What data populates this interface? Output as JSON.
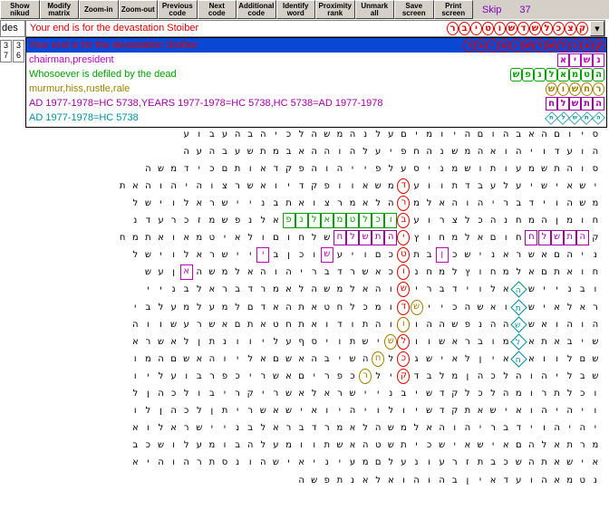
{
  "toolbar": {
    "buttons": [
      {
        "label": "Show\nnikud"
      },
      {
        "label": "Modify\nmatrix"
      },
      {
        "label": "Zoom-in"
      },
      {
        "label": "Zoom-out"
      },
      {
        "label": "Previous\ncode"
      },
      {
        "label": "Next\ncode"
      },
      {
        "label": "Additional\ncode"
      },
      {
        "label": "Identify\nword"
      },
      {
        "label": "Proximity\nrank"
      },
      {
        "label": "Unmark\nall"
      },
      {
        "label": "Save\nscreen"
      },
      {
        "label": "Print\nscreen"
      }
    ],
    "skip_label": "Skip",
    "skip_value": "37"
  },
  "des_box": {
    "value": "des"
  },
  "combo": {
    "value": "Your end is for the devastation Stoiber",
    "glyphs": [
      "ק",
      "צ",
      "כ",
      "ל",
      "ש",
      "ד",
      "ש",
      "ו",
      "ט",
      "י",
      "ב",
      "ר"
    ],
    "glyph_color": "#e00000"
  },
  "dropdown": {
    "items": [
      {
        "text": "Your end is for the devastation Stoiber",
        "color": "#e00000",
        "glyphs": [
          "ק",
          "צ",
          "כ",
          "ל",
          "ש",
          "ד",
          "ש",
          "ו",
          "ט",
          "י",
          "ב",
          "ר"
        ],
        "shape": "oval",
        "gcolor": "#e00000",
        "selected": true
      },
      {
        "text": "chairman,president",
        "color": "#c000c0",
        "glyphs": [
          "נ",
          "ש",
          "י",
          "א"
        ],
        "shape": "box",
        "gcolor": "#c000c0",
        "selected": false
      },
      {
        "text": "Whosoever is defiled by the dead",
        "color": "#00a000",
        "glyphs": [
          "ה",
          "ט",
          "מ",
          "א",
          "ל",
          "נ",
          "פ",
          "ש"
        ],
        "shape": "hex",
        "gcolor": "#00a000",
        "selected": false
      },
      {
        "text": "murmur,hiss,rustle,rale",
        "color": "#a08000",
        "glyphs": [
          "ר",
          "ח",
          "ש",
          "ו",
          "ש"
        ],
        "shape": "oval",
        "gcolor": "#a08000",
        "selected": false
      },
      {
        "text": "AD 1977-1978=HC 5738,YEARS 1977-1978=HC 5738,HC 5738=AD 1977-1978",
        "color": "#a000a0",
        "glyphs": [
          "ה",
          "ת",
          "ש",
          "ל",
          "ח"
        ],
        "shape": "box",
        "gcolor": "#a000a0",
        "selected": false
      },
      {
        "text": "AD 1977-1978=HC 5738",
        "color": "#0090a0",
        "glyphs": [
          "ה",
          "ת",
          "ש",
          "ל",
          "ח"
        ],
        "shape": "diamond",
        "gcolor": "#0090a0",
        "selected": false
      }
    ]
  },
  "mini_cells": [
    "3\n7",
    "3\n6"
  ],
  "grid_rows": [
    "",
    "",
    "",
    "",
    "",
    "ס י ו ם ה א ב ה ו ם ה י ו מ י ם ע ל נ ה מ ש ה ל כ י ה ב ה ע ב ו ע",
    "ה ו ע ד ו י ה ו א ה מ ש נ ה ח פ י ע ל ה ו ה ה א ב מ ת ש ע ב ה ע ה",
    "ס ו ה ת ש מ ע ו ת ו ש מ נ י ס ע ל פ י י ה ו ה פ ק ד א ו ת ם כ י ד מ ש ה",
    "י ש א י ש י ע ל ע ב ד ת ו ו ע ל מ ש א ו ו פ ק ד י ו א ש ר צ ו ה י ה ו ה א ת",
    "מ ש ה ו י ד ב ר י ה ו ה א ל מ ש ה ל א מ ר צ ו א ת ב נ י י ש ר א ל ו י ש ל",
    "ח ו מ ן ה מ ח נ ה כ ל צ ר ו ע ו כ ל ז ב ו כ ל ט מ א ל נ פ ש מ ז כ ר ע ד נ",
    "ק ב ה ת ש ל ח ו ם א ל מ ח ו ץ ל מ ח נ ה ת ש ל ח ו ם ו ל א י ט מ א ו א ת מ ח",
    "נ י ה ם א ש ר א נ י ש כ ן ב ת ו כ ם ו י ע ש ו כ ן ב נ י י ש ר א ל ו י ש ל",
    "ח ו א ת ם א ל מ ח ו ץ ל מ ח נ ה כ א ש ר ד ב ר י ה ו ה א ל מ ש ה כ ן ע ש",
    "ו ב נ י י ש ר א ל ו י ד ב ר י ה ו ה א ל מ ש ה ל א מ ר ד ב ר א ל ב נ י י",
    "ר א ל א י ש א ו א ש ה כ י י ע ש ו מ כ ל ח ט א ת ה א ד ם ל מ ע ל מ ע ל ב י",
    "ה ו ה ו א ש מ ה ה נ פ ש ה ה ו א ו ה ת ו ד ו א ת ח ט א ת ם א ש ר ע ש ו ו ה",
    "ש י ב א ת א ש מ ו ב ר א ש ו ו ח מ י ש ת ו י ס ף ע ל י ו ו נ ת ן ל א ש ר א",
    "ש ם ל ו ו א ם א י ן ל א י ש ג א ל ל ה ש י ב ה א ש ם א ל י ו ה א ש ם ה מ ו",
    "ש ב ל י ה ו ה ל כ ה ן מ ל ב ד א י ל ה כ פ ר י ם א ש ר י כ פ ר ב ו ע ל י ו",
    "ו כ ל ת ר ו מ ה ל כ ל ק ד ש י ב נ י י ש ר א ל א ש ר י ק ר י ב ו ל כ ה ן ל",
    "ו י ה י ה ו א י ש א ת ק ד ש י ו ל ו י ה י ו א י ש א ש ר י ת ן ל כ ה ן ל ו",
    "י ה י ה ו י ד ב ר י ה ו ה א ל מ ש ה ל א מ ר ד ב ר א ל ב נ י י ש ר א ל ו א",
    "מ ר ת א ל ה ם א י ש א י ש כ י ת ש ט ה א ש ת ו ו מ ע ל ה ב ו מ ע ל ו ש כ ב",
    "א י ש א ת ה ש כ ב ת ז ר ע ו נ ע ל ם מ ע י נ י א י ש ה ו נ ס ת ר ה ו ה י א",
    "נ ט מ א ה ו ע ד א י ן ב ה ו ה ו א ל א נ ת פ ש ה"
  ],
  "marks": [
    {
      "row": 8,
      "col": 15,
      "shape": "oval",
      "color": "#e00000",
      "ch": "ד"
    },
    {
      "row": 9,
      "col": 15,
      "shape": "oval",
      "color": "#e00000",
      "ch": "ר"
    },
    {
      "row": 10,
      "col": 15,
      "shape": "oval",
      "color": "#e00000",
      "ch": "ב"
    },
    {
      "row": 11,
      "col": 15,
      "shape": "oval",
      "color": "#e00000",
      "ch": "י"
    },
    {
      "row": 12,
      "col": 15,
      "shape": "oval",
      "color": "#e00000",
      "ch": "ט"
    },
    {
      "row": 13,
      "col": 15,
      "shape": "oval",
      "color": "#e00000",
      "ch": "ו"
    },
    {
      "row": 14,
      "col": 15,
      "shape": "oval",
      "color": "#e00000",
      "ch": "ש"
    },
    {
      "row": 15,
      "col": 15,
      "shape": "oval",
      "color": "#e00000",
      "ch": "ד"
    },
    {
      "row": 16,
      "col": 15,
      "shape": "oval",
      "color": "#e00000",
      "ch": "ש"
    },
    {
      "row": 17,
      "col": 15,
      "shape": "oval",
      "color": "#e00000",
      "ch": "ל"
    },
    {
      "row": 18,
      "col": 15,
      "shape": "oval",
      "color": "#e00000",
      "ch": "כ"
    },
    {
      "row": 19,
      "col": 15,
      "shape": "oval",
      "color": "#e00000",
      "ch": "ק"
    },
    {
      "row": 10,
      "col": 16,
      "shape": "hex",
      "color": "#00a000",
      "ch": "ו"
    },
    {
      "row": 10,
      "col": 17,
      "shape": "hex",
      "color": "#00a000",
      "ch": "כ"
    },
    {
      "row": 10,
      "col": 18,
      "shape": "hex",
      "color": "#00a000",
      "ch": "ל"
    },
    {
      "row": 10,
      "col": 19,
      "shape": "hex",
      "color": "#00a000",
      "ch": "ט"
    },
    {
      "row": 10,
      "col": 20,
      "shape": "hex",
      "color": "#00a000",
      "ch": "מ"
    },
    {
      "row": 10,
      "col": 21,
      "shape": "hex",
      "color": "#00a000",
      "ch": "א"
    },
    {
      "row": 10,
      "col": 22,
      "shape": "hex",
      "color": "#00a000",
      "ch": "ל"
    },
    {
      "row": 10,
      "col": 23,
      "shape": "hex",
      "color": "#00a000",
      "ch": "נ"
    },
    {
      "row": 10,
      "col": 24,
      "shape": "hex",
      "color": "#00a000",
      "ch": "פ"
    },
    {
      "row": 11,
      "col": 1,
      "shape": "box",
      "color": "#a000a0",
      "ch": "ה"
    },
    {
      "row": 11,
      "col": 2,
      "shape": "box",
      "color": "#a000a0",
      "ch": "ת"
    },
    {
      "row": 11,
      "col": 3,
      "shape": "box",
      "color": "#a000a0",
      "ch": "ש"
    },
    {
      "row": 11,
      "col": 4,
      "shape": "box",
      "color": "#a000a0",
      "ch": "ל"
    },
    {
      "row": 11,
      "col": 5,
      "shape": "box",
      "color": "#a000a0",
      "ch": "ח"
    },
    {
      "row": 11,
      "col": 16,
      "shape": "box",
      "color": "#a000a0",
      "ch": "ה"
    },
    {
      "row": 11,
      "col": 17,
      "shape": "box",
      "color": "#a000a0",
      "ch": "ת"
    },
    {
      "row": 11,
      "col": 18,
      "shape": "box",
      "color": "#a000a0",
      "ch": "ש"
    },
    {
      "row": 11,
      "col": 19,
      "shape": "box",
      "color": "#a000a0",
      "ch": "ל"
    },
    {
      "row": 11,
      "col": 20,
      "shape": "box",
      "color": "#a000a0",
      "ch": "ח"
    },
    {
      "row": 12,
      "col": 12,
      "shape": "box",
      "color": "#c000c0",
      "ch": "ן"
    },
    {
      "row": 12,
      "col": 21,
      "shape": "box",
      "color": "#c000c0",
      "ch": "ש"
    },
    {
      "row": 12,
      "col": 26,
      "shape": "box",
      "color": "#c000c0",
      "ch": "י"
    },
    {
      "row": 13,
      "col": 32,
      "shape": "box",
      "color": "#c000c0",
      "ch": "א"
    },
    {
      "row": 14,
      "col": 6,
      "shape": "diamond",
      "color": "#0090a0",
      "ch": "ה"
    },
    {
      "row": 15,
      "col": 6,
      "shape": "diamond",
      "color": "#0090a0",
      "ch": "ת"
    },
    {
      "row": 16,
      "col": 6,
      "shape": "diamond",
      "color": "#0090a0",
      "ch": "ש"
    },
    {
      "row": 17,
      "col": 6,
      "shape": "diamond",
      "color": "#0090a0",
      "ch": "ל"
    },
    {
      "row": 18,
      "col": 6,
      "shape": "diamond",
      "color": "#0090a0",
      "ch": "ח"
    },
    {
      "row": 15,
      "col": 14,
      "shape": "oval",
      "color": "#a08000",
      "ch": "ש"
    },
    {
      "row": 16,
      "col": 15,
      "shape": "oval",
      "color": "#a08000",
      "ch": "ו"
    },
    {
      "row": 17,
      "col": 16,
      "shape": "oval",
      "color": "#a08000",
      "ch": "ש"
    },
    {
      "row": 18,
      "col": 17,
      "shape": "oval",
      "color": "#a08000",
      "ch": "ח"
    },
    {
      "row": 19,
      "col": 18,
      "shape": "oval",
      "color": "#a08000",
      "ch": "ר"
    }
  ]
}
